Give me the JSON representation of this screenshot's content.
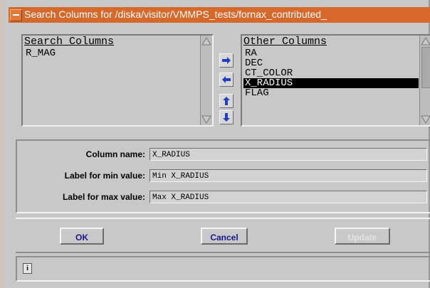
{
  "window": {
    "title": "Search Columns for /diska/visitor/VMMPS_tests/fornax_contributed_"
  },
  "search_columns": {
    "header": "Search Columns",
    "items": [
      "R_MAG"
    ]
  },
  "other_columns": {
    "header": "Other Columns",
    "items": [
      "RA",
      "DEC",
      "CT_COLOR",
      "X_RADIUS",
      "FLAG"
    ],
    "selected": "X_RADIUS"
  },
  "move_buttons": [
    "arrow-right-icon",
    "arrow-left-icon",
    "arrow-up-icon",
    "arrow-down-icon"
  ],
  "form": {
    "column_name_label": "Column name:",
    "column_name_value": "X_RADIUS",
    "min_label": "Label for min value:",
    "min_value": "Min X_RADIUS",
    "max_label": "Label for max value:",
    "max_value": "Max X_RADIUS"
  },
  "buttons": {
    "ok": "OK",
    "cancel": "Cancel",
    "update": "Update"
  },
  "status": {
    "icon": "i"
  },
  "colors": {
    "titlebar": "#d7682b",
    "move_arrow": "#1f3fbf",
    "button_text": "#19198c"
  }
}
